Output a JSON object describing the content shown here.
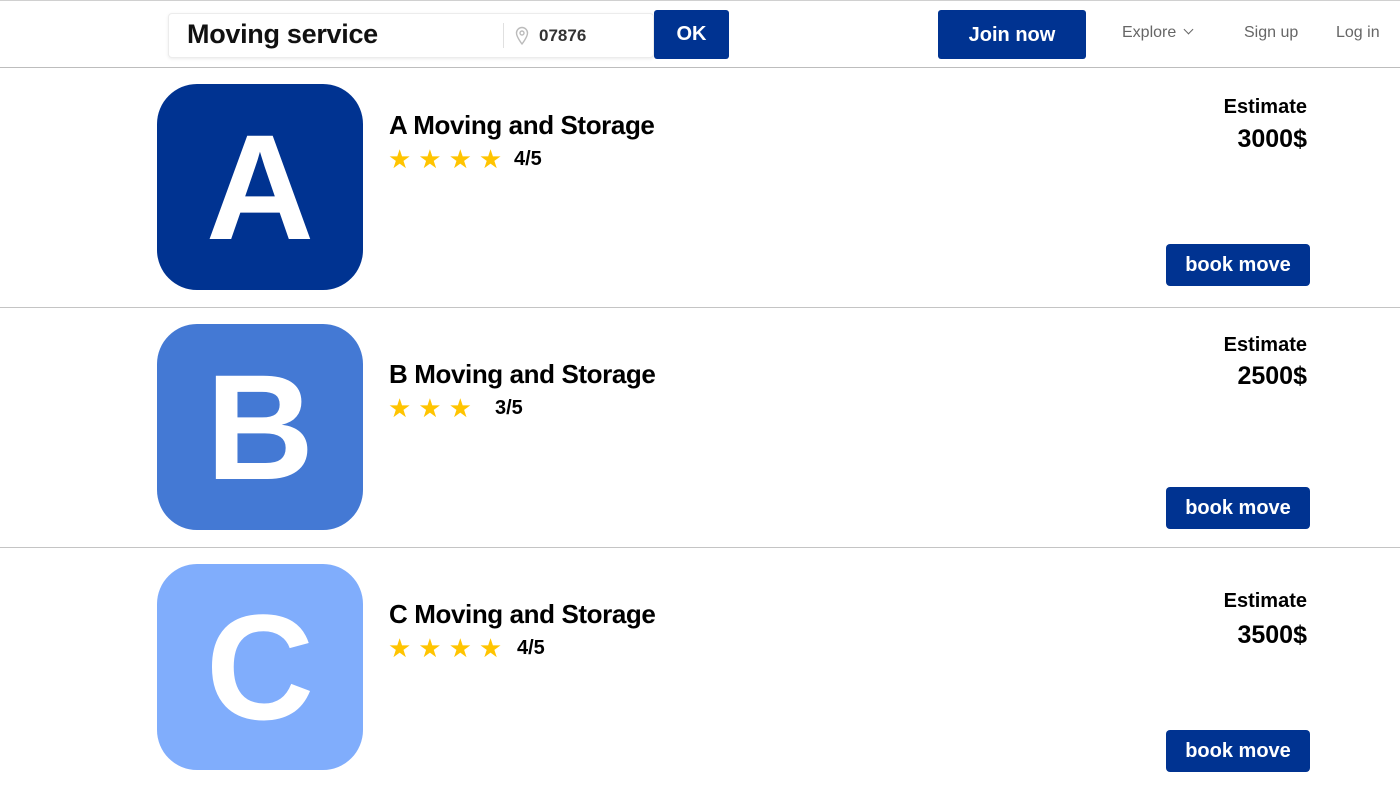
{
  "header": {
    "search_value": "Moving service",
    "zip_value": "07876",
    "ok_label": "OK",
    "join_label": "Join now",
    "explore_label": "Explore",
    "signup_label": "Sign up",
    "login_label": "Log in"
  },
  "colors": {
    "brand": "#003391",
    "star": "#ffc400"
  },
  "listings": [
    {
      "letter": "A",
      "logo_color": "#003391",
      "name": "A Moving and Storage",
      "stars": "★★★★",
      "rating": "4/5",
      "estimate_label": "Estimate",
      "estimate": "3000$",
      "book_label": "book move"
    },
    {
      "letter": "B",
      "logo_color": "#4479d4",
      "name": "B Moving and Storage",
      "stars": "★★★",
      "rating": "3/5",
      "estimate_label": "Estimate",
      "estimate": "2500$",
      "book_label": "book move"
    },
    {
      "letter": "C",
      "logo_color": "#80adfc",
      "name": "C Moving and Storage",
      "stars": "★★★★",
      "rating": "4/5",
      "estimate_label": "Estimate",
      "estimate": "3500$",
      "book_label": "book move"
    }
  ]
}
